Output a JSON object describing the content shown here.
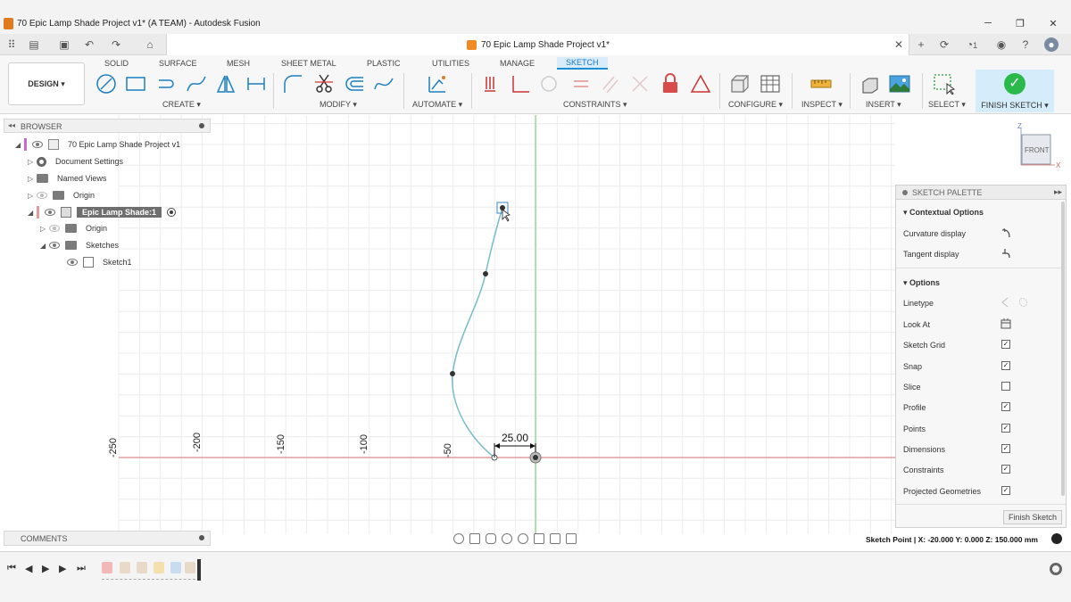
{
  "window": {
    "title": "70 Epic Lamp Shade Project v1* (A TEAM) - Autodesk Fusion",
    "minimize": "─",
    "maximize": "❐",
    "close": "✕"
  },
  "doc_tab": {
    "title": "70 Epic Lamp Shade Project v1*",
    "close": "✕",
    "notification_count": "1"
  },
  "ribbon": {
    "workspace": "DESIGN ▾",
    "tabs": [
      "SOLID",
      "SURFACE",
      "MESH",
      "SHEET METAL",
      "PLASTIC",
      "UTILITIES",
      "MANAGE",
      "SKETCH"
    ],
    "active_tab": "SKETCH",
    "groups": [
      "CREATE ▾",
      "MODIFY ▾",
      "AUTOMATE ▾",
      "CONSTRAINTS ▾",
      "CONFIGURE ▾",
      "INSPECT ▾",
      "INSERT ▾",
      "SELECT ▾"
    ],
    "finish_sketch": "FINISH SKETCH ▾"
  },
  "browser": {
    "title": "BROWSER",
    "items": [
      {
        "label": "70 Epic Lamp Shade Project v1"
      },
      {
        "label": "Document Settings"
      },
      {
        "label": "Named Views"
      },
      {
        "label": "Origin"
      },
      {
        "label": "Epic Lamp Shade:1"
      },
      {
        "label": "Origin"
      },
      {
        "label": "Sketches"
      },
      {
        "label": "Sketch1"
      }
    ]
  },
  "comments": {
    "title": "COMMENTS"
  },
  "canvas": {
    "axis_labels": [
      "-250",
      "-200",
      "-150",
      "-100",
      "-50"
    ],
    "dimension": "25.00",
    "viewcube_face": "FRONT",
    "axis_z": "Z",
    "axis_x": "X"
  },
  "palette": {
    "title": "SKETCH PALETTE",
    "sections": {
      "contextual": "Contextual Options",
      "options": "Options"
    },
    "contextual_rows": [
      "Curvature display",
      "Tangent display"
    ],
    "option_rows": [
      {
        "label": "Linetype"
      },
      {
        "label": "Look At"
      },
      {
        "label": "Sketch Grid",
        "checked": true
      },
      {
        "label": "Snap",
        "checked": true
      },
      {
        "label": "Slice",
        "checked": false
      },
      {
        "label": "Profile",
        "checked": true
      },
      {
        "label": "Points",
        "checked": true
      },
      {
        "label": "Dimensions",
        "checked": true
      },
      {
        "label": "Constraints",
        "checked": true
      },
      {
        "label": "Projected Geometries",
        "checked": true
      }
    ],
    "finish_button": "Finish Sketch",
    "check_mark": "✓"
  },
  "status": {
    "text": "Sketch Point | X: -20.000 Y: 0.000 Z: 150.000 mm"
  },
  "timeline": {
    "first": "⏮",
    "prev": "◀",
    "play": "▶",
    "next": "▶",
    "last": "⏭"
  },
  "colors": {
    "accent": "#1d8fd6",
    "sketch_curve": "#77bcc8",
    "x_axis": "#d98b8b",
    "z_axis": "#8ad08a",
    "finish_green": "#2bb94b"
  }
}
